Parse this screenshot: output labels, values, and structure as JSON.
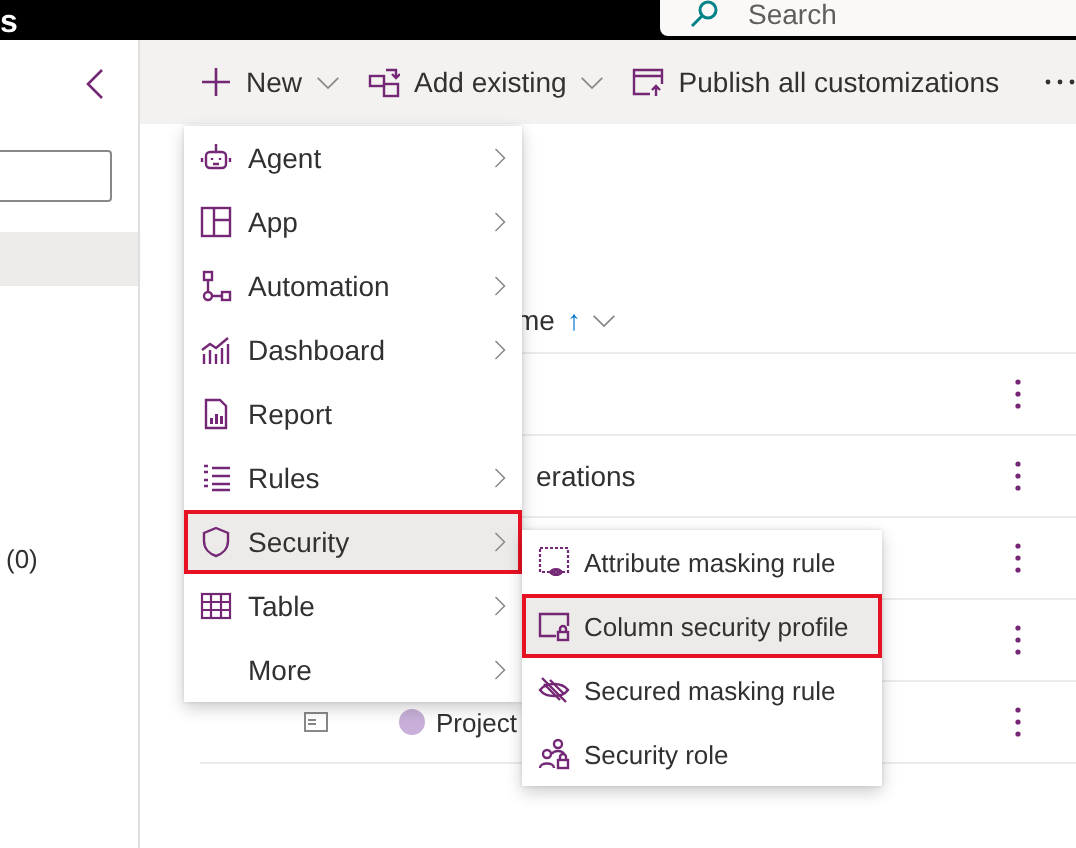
{
  "header": {
    "title": "s",
    "search": {
      "placeholder": "Search"
    }
  },
  "toolbar": {
    "buttons": [
      {
        "label": "New",
        "kind": "plus",
        "dropdown": true
      },
      {
        "label": "Add existing",
        "kind": "add-existing",
        "dropdown": true
      },
      {
        "label": "Publish all customizations",
        "kind": "publish",
        "dropdown": false
      }
    ]
  },
  "sidebar": {
    "count": "(0)"
  },
  "table": {
    "header": {
      "label": "me",
      "sort": "↑"
    },
    "rows": [
      {
        "name": ""
      },
      {
        "name": "erations"
      },
      {
        "name": ""
      },
      {
        "name": ""
      },
      {
        "name": "Project",
        "icon": true
      }
    ]
  },
  "menu": {
    "items": [
      {
        "label": "Agent",
        "kind": "agent",
        "submenu": true,
        "selected": false,
        "highlighted": false
      },
      {
        "label": "App",
        "kind": "app",
        "submenu": true,
        "selected": false,
        "highlighted": false
      },
      {
        "label": "Automation",
        "kind": "automation",
        "submenu": true,
        "selected": false,
        "highlighted": false
      },
      {
        "label": "Dashboard",
        "kind": "dashboard",
        "submenu": true,
        "selected": false,
        "highlighted": false
      },
      {
        "label": "Report",
        "kind": "report",
        "submenu": false,
        "selected": false,
        "highlighted": false
      },
      {
        "label": "Rules",
        "kind": "rules",
        "submenu": true,
        "selected": false,
        "highlighted": false
      },
      {
        "label": "Security",
        "kind": "security",
        "submenu": true,
        "selected": true,
        "highlighted": true
      },
      {
        "label": "Table",
        "kind": "table",
        "submenu": true,
        "selected": false,
        "highlighted": false
      },
      {
        "label": "More",
        "kind": "plain",
        "submenu": true,
        "selected": false,
        "highlighted": false
      }
    ]
  },
  "submenu": {
    "items": [
      {
        "label": "Attribute masking rule",
        "kind": "mask",
        "selected": false,
        "highlighted": false
      },
      {
        "label": "Column security profile",
        "kind": "column-lock",
        "selected": true,
        "highlighted": true
      },
      {
        "label": "Secured masking rule",
        "kind": "eye-off",
        "selected": false,
        "highlighted": false
      },
      {
        "label": "Security role",
        "kind": "role",
        "selected": false,
        "highlighted": false
      }
    ]
  }
}
